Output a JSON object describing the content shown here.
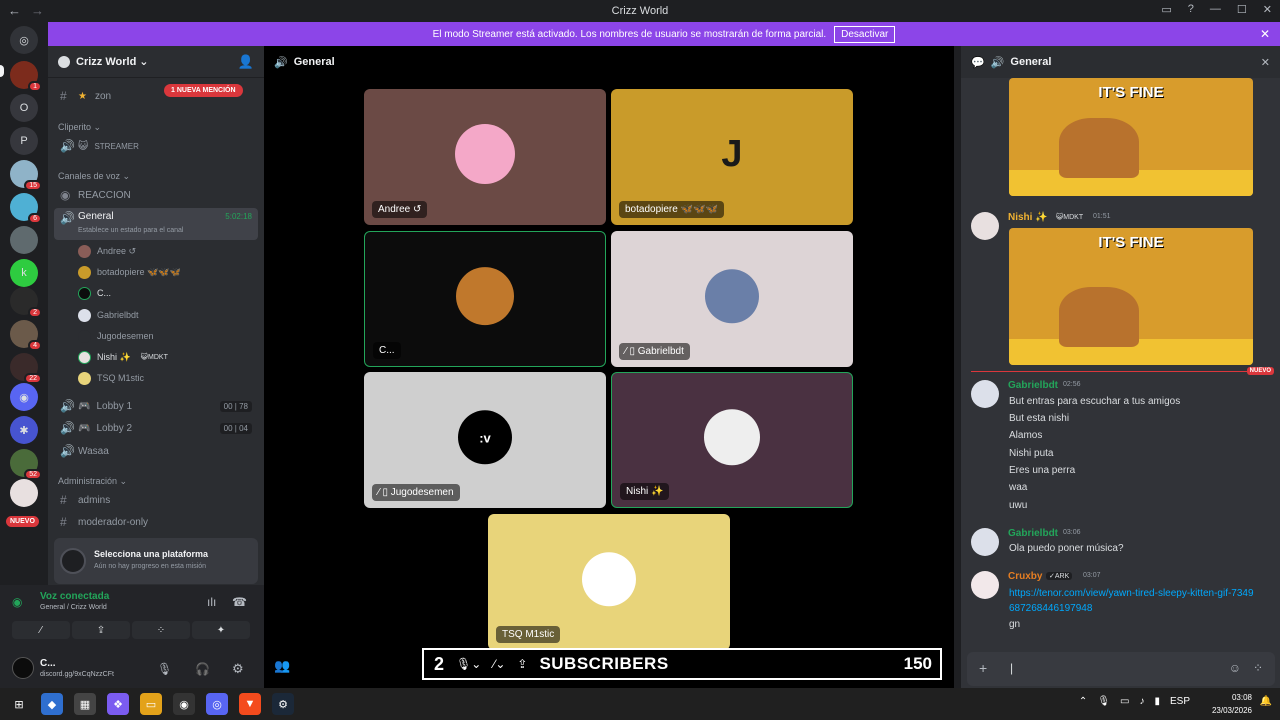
{
  "titlebar": {
    "back": "←",
    "forward": "→",
    "title": "Crizz World"
  },
  "banner": {
    "text": "El modo Streamer está activado. Los nombres de usuario se mostrarán de forma parcial.",
    "button": "Desactivar"
  },
  "guild_badges": [
    "1",
    "15",
    "6",
    "2",
    "4",
    "22",
    "52"
  ],
  "guild_letters": [
    "O",
    "P"
  ],
  "new_label": "NUEVO",
  "server": {
    "name": "Crizz World"
  },
  "mention_pill": "1 NUEVA MENCIÓN",
  "channels": {
    "zone": "zon",
    "cat_cliperito": "Cliperito",
    "streamer": "STREAMER",
    "cat_voice": "Canales de voz",
    "reaccion": "REACCION",
    "general": "General",
    "general_time": "5:02:18",
    "status_hint": "Establece un estado para el canal",
    "members": [
      "Andree ↺",
      "botadopiere 🦋🦋🦋",
      "C...",
      "Gabrielbdt",
      "Jugodesemen",
      "Nishi ✨",
      "TSQ M1stic"
    ],
    "nishi_tag": "😺MDKT",
    "lobby1": "Lobby 1",
    "lobby1_a": "00",
    "lobby1_b": "78",
    "lobby2": "Lobby 2",
    "lobby2_a": "00",
    "lobby2_b": "04",
    "wasaa": "Wasaa",
    "cat_admin": "Administración",
    "admins": "admins",
    "modonly": "moderador-only"
  },
  "platform": {
    "title": "Selecciona una plataforma",
    "sub": "Aún no hay progreso en esta misión"
  },
  "voice": {
    "status": "Voz conectada",
    "where": "General / Crizz World"
  },
  "user": {
    "name": "C...",
    "sub": "discord.gg/9xCqNzzCFt"
  },
  "main": {
    "title": "General"
  },
  "tiles": [
    {
      "name": "Andree ↺",
      "bg": "#6b4a45"
    },
    {
      "name": "botadopiere 🦋🦋🦋",
      "bg": "#c99b2a",
      "letter": "J"
    },
    {
      "name": "C...",
      "bg": "#0c0c0c"
    },
    {
      "name": "Gabrielbdt",
      "bg": "#ddd4d6"
    },
    {
      "name": "Jugodesemen",
      "bg": "#cfcfcf",
      "letter": ":v"
    },
    {
      "name": "Nishi ✨",
      "bg": "#4a3141"
    },
    {
      "name": "TSQ M1stic",
      "bg": "#e8d47a"
    }
  ],
  "overlay": {
    "number": "2",
    "subscribers": "SUBSCRIBERS",
    "count": "150"
  },
  "chat": {
    "title": "General",
    "gif_text": "IT'S FINE",
    "nishi_name": "Nishi ✨",
    "nishi_tag": "😺MDKT",
    "nishi_time": "01:51",
    "new_divider": "NUEVO",
    "g1_name": "Gabrielbdt",
    "g1_time": "02:56",
    "g1_lines": [
      "But entras para escuchar a tus amigos",
      "But esta nishi",
      "Alamos",
      "Nishi puta",
      "Eres una perra",
      "waa",
      "uwu"
    ],
    "g2_name": "Gabrielbdt",
    "g2_time": "03:06",
    "g2_line": "Ola puedo poner música?",
    "c_name": "Cruxby",
    "c_tag": "✓ARK",
    "c_time": "03:07",
    "c_link": "https://tenor.com/view/yawn-tired-sleepy-kitten-gif-7349687268446197948",
    "c_line": "gn"
  },
  "taskbar": {
    "lang": "ESP",
    "time": "03:08",
    "date": "23/03/2026"
  }
}
